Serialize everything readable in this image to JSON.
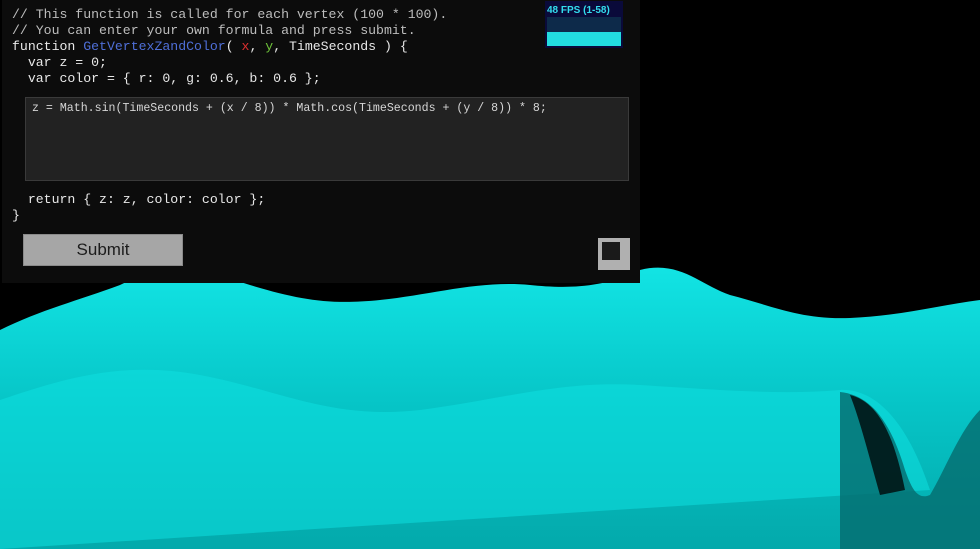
{
  "code": {
    "comment_1": "// This function is called for each vertex (100 * 100).",
    "comment_2": "// You can enter your own formula and press submit.",
    "keyword_function": "function",
    "function_name": "GetVertexZandColor",
    "open_paren": "( ",
    "param_x": "x",
    "comma_1": ", ",
    "param_y": "y",
    "comma_2": ", ",
    "param_time": "TimeSeconds",
    "signature_end": " ) {",
    "var_z": "  var z = 0;",
    "var_color": "  var color = { r: 0, g: 0.6, b: 0.6 };",
    "return_line": "  return { z: z, color: color };",
    "closing_brace": "}"
  },
  "formula": {
    "value": "z = Math.sin(TimeSeconds + (x / 8)) * Math.cos(TimeSeconds + (y / 8)) * 8;"
  },
  "controls": {
    "submit_label": "Submit"
  },
  "stats": {
    "fps_label": "48 FPS (1-58)",
    "fps_current": 48,
    "fps_min": 1,
    "fps_max": 58
  },
  "colors": {
    "surface": "#00e5e5",
    "background": "#000000",
    "panel": "#0c0c0c",
    "fps_text": "#33ddee"
  }
}
